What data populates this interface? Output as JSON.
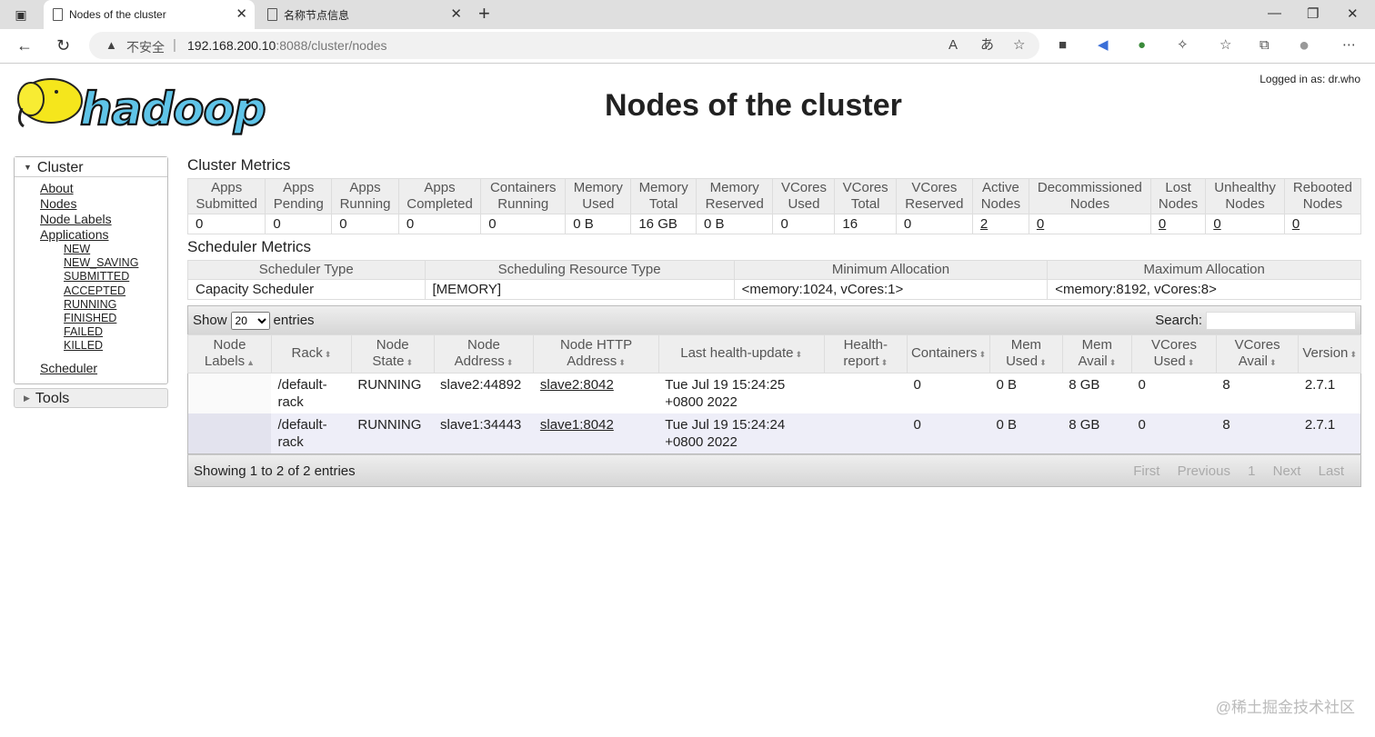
{
  "browser": {
    "tabs": [
      {
        "title": "Nodes of the cluster"
      },
      {
        "title": "名称节点信息"
      }
    ],
    "security_label": "不安全",
    "url_host": "192.168.200.10",
    "url_rest": ":8088/cluster/nodes"
  },
  "page": {
    "title": "Nodes of the cluster",
    "logged_in": "Logged in as: dr.who",
    "logo_text": "hadoop"
  },
  "sidebar": {
    "cluster_label": "Cluster",
    "links": [
      "About",
      "Nodes",
      "Node Labels",
      "Applications"
    ],
    "app_states": [
      "NEW",
      "NEW_SAVING",
      "SUBMITTED",
      "ACCEPTED",
      "RUNNING",
      "FINISHED",
      "FAILED",
      "KILLED"
    ],
    "scheduler": "Scheduler",
    "tools_label": "Tools"
  },
  "cluster_metrics": {
    "heading": "Cluster Metrics",
    "headers": [
      "Apps Submitted",
      "Apps Pending",
      "Apps Running",
      "Apps Completed",
      "Containers Running",
      "Memory Used",
      "Memory Total",
      "Memory Reserved",
      "VCores Used",
      "VCores Total",
      "VCores Reserved",
      "Active Nodes",
      "Decommissioned Nodes",
      "Lost Nodes",
      "Unhealthy Nodes",
      "Rebooted Nodes"
    ],
    "values": [
      "0",
      "0",
      "0",
      "0",
      "0",
      "0 B",
      "16 GB",
      "0 B",
      "0",
      "16",
      "0",
      "2",
      "0",
      "0",
      "0",
      "0"
    ]
  },
  "scheduler_metrics": {
    "heading": "Scheduler Metrics",
    "headers": [
      "Scheduler Type",
      "Scheduling Resource Type",
      "Minimum Allocation",
      "Maximum Allocation"
    ],
    "values": [
      "Capacity Scheduler",
      "[MEMORY]",
      "<memory:1024, vCores:1>",
      "<memory:8192, vCores:8>"
    ]
  },
  "nodes_table": {
    "show_label": "Show",
    "entries_label": "entries",
    "page_size": "20",
    "search_label": "Search:",
    "headers": [
      "Node Labels",
      "Rack",
      "Node State",
      "Node Address",
      "Node HTTP Address",
      "Last health-update",
      "Health-report",
      "Containers",
      "Mem Used",
      "Mem Avail",
      "VCores Used",
      "VCores Avail",
      "Version"
    ],
    "rows": [
      {
        "labels": "",
        "rack": "/default-rack",
        "state": "RUNNING",
        "address": "slave2:44892",
        "http": "slave2:8042",
        "health_update": "Tue Jul 19 15:24:25 +0800 2022",
        "health_report": "",
        "containers": "0",
        "mem_used": "0 B",
        "mem_avail": "8 GB",
        "vcores_used": "0",
        "vcores_avail": "8",
        "version": "2.7.1"
      },
      {
        "labels": "",
        "rack": "/default-rack",
        "state": "RUNNING",
        "address": "slave1:34443",
        "http": "slave1:8042",
        "health_update": "Tue Jul 19 15:24:24 +0800 2022",
        "health_report": "",
        "containers": "0",
        "mem_used": "0 B",
        "mem_avail": "8 GB",
        "vcores_used": "0",
        "vcores_avail": "8",
        "version": "2.7.1"
      }
    ],
    "info": "Showing 1 to 2 of 2 entries",
    "pager": [
      "First",
      "Previous",
      "1",
      "Next",
      "Last"
    ]
  },
  "watermark": "@稀土掘金技术社区"
}
